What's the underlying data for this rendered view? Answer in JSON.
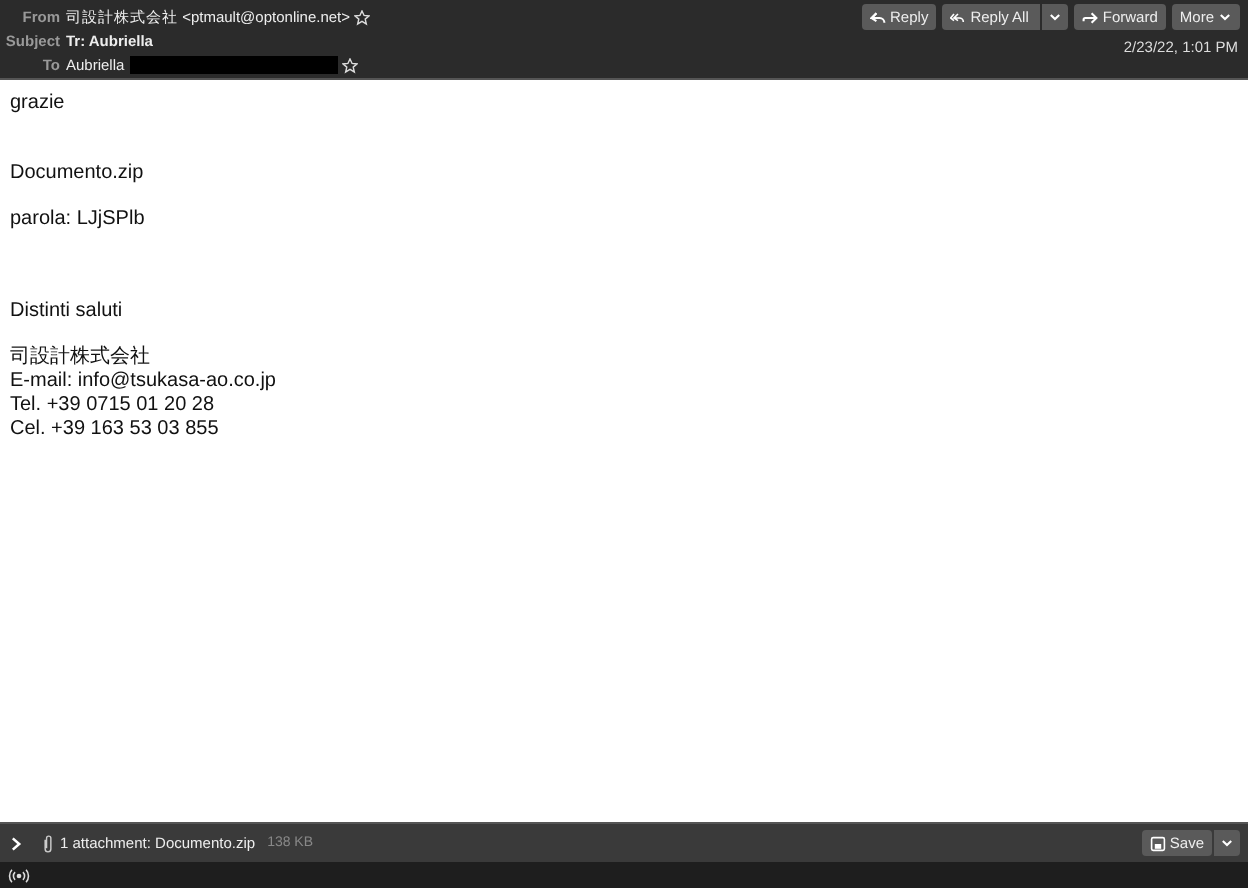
{
  "header": {
    "from_label": "From",
    "from": "司設計株式会社 <ptmault@optonline.net>",
    "from_starred": false,
    "subject_label": "Subject",
    "subject": "Tr: Aubriella",
    "to_label": "To",
    "to": "Aubriella",
    "to_starred": false,
    "to_redacted": true,
    "buttons": [
      {
        "label": "Reply",
        "kind": "reply",
        "menu": false
      },
      {
        "label": "Reply All",
        "kind": "replyall",
        "menu": true
      },
      {
        "label": "Forward",
        "kind": "forward",
        "menu": false
      },
      {
        "label": "More",
        "kind": "more",
        "menu": false
      }
    ],
    "date": "2/23/22, 1:01 PM"
  },
  "body": {
    "paragraphs": [
      [
        "grazie"
      ],
      [
        "Documento.zip"
      ],
      [
        "parola: LJjSPlb"
      ],
      [
        "Distinti saluti"
      ],
      [
        "司設計株式会社",
        "E-mail: info@tsukasa-ao.co.jp",
        "Tel. +39 0715 01 20 28",
        "Cel. +39 163 53 03 855"
      ]
    ]
  },
  "attachments": {
    "expanded": false,
    "summary": "1 attachment: Documento.zip",
    "size": "138 KB",
    "save": "Save"
  }
}
